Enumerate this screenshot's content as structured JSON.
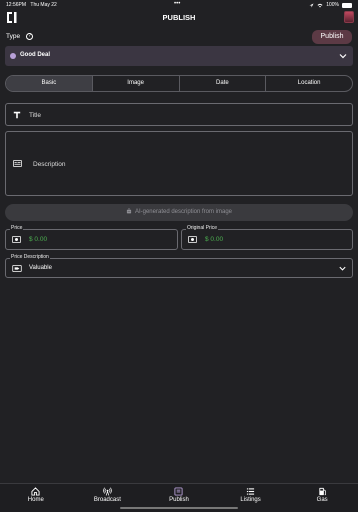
{
  "status_bar": {
    "time": "12:56PM",
    "date": "Thu May 22",
    "battery": "100%"
  },
  "header": {
    "title": "PUBLISH"
  },
  "type_row": {
    "label": "Type",
    "help": "?",
    "publish_label": "Publish"
  },
  "category": {
    "label": "Good Deal"
  },
  "tabs": [
    {
      "label": "Basic"
    },
    {
      "label": "Image"
    },
    {
      "label": "Date"
    },
    {
      "label": "Location"
    }
  ],
  "form": {
    "title_placeholder": "Title",
    "description_placeholder": "Description",
    "ai_button_label": "AI-generated description from image",
    "price_label": "Price",
    "price_value": "$ 0.00",
    "original_price_label": "Original Price",
    "original_price_value": "$ 0.00",
    "price_description_label": "Price Description",
    "price_description_value": "Valuable"
  },
  "bottom_nav": [
    {
      "label": "Home",
      "icon": "home-icon"
    },
    {
      "label": "Broadcast",
      "icon": "broadcast-icon"
    },
    {
      "label": "Publish",
      "icon": "publish-icon"
    },
    {
      "label": "Listings",
      "icon": "listings-icon"
    },
    {
      "label": "Gas",
      "icon": "gas-icon"
    }
  ],
  "colors": {
    "background": "#212124",
    "accent": "#5c3a45",
    "price_green": "#4caf50",
    "category_bg": "#3b3642"
  }
}
